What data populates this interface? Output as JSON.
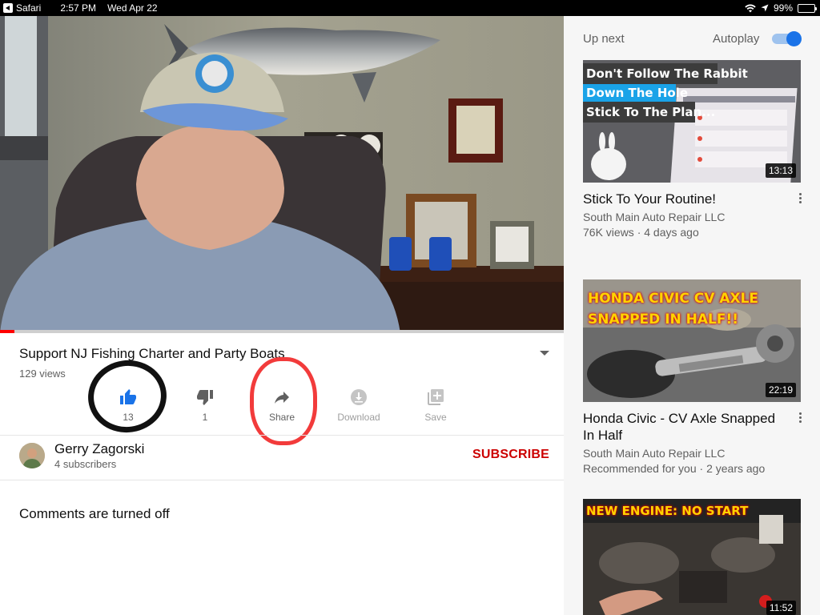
{
  "status_bar": {
    "app": "Safari",
    "time": "2:57 PM",
    "date": "Wed Apr 22",
    "battery": "99%"
  },
  "player": {
    "progress_percent": 2.5,
    "title": "Support NJ Fishing Charter and Party Boats",
    "views": "129 views",
    "actions": {
      "like_count": "13",
      "dislike_count": "1",
      "share_label": "Share",
      "download_label": "Download",
      "save_label": "Save"
    }
  },
  "channel": {
    "name": "Gerry Zagorski",
    "subscribers": "4 subscribers",
    "subscribe_label": "SUBSCRIBE"
  },
  "comments": {
    "status": "Comments are turned off"
  },
  "sidebar": {
    "up_next_label": "Up next",
    "autoplay_label": "Autoplay",
    "videos": [
      {
        "thumb_lines": [
          "Don't Follow The Rabbit",
          "Down The Hole",
          "Stick To The Plan..."
        ],
        "duration": "13:13",
        "title": "Stick To Your Routine!",
        "channel": "South Main Auto Repair LLC",
        "meta": "76K views · 4 days ago"
      },
      {
        "thumb_lines": [
          "HONDA CIVIC CV AXLE",
          "SNAPPED IN HALF!!"
        ],
        "duration": "22:19",
        "title": "Honda Civic - CV Axle Snapped In Half",
        "channel": "South Main Auto Repair LLC",
        "meta": "Recommended for you · 2 years ago"
      },
      {
        "thumb_lines": [
          "NEW ENGINE: NO START"
        ],
        "duration": "11:52"
      }
    ]
  },
  "colors": {
    "subscribe_red": "#cc0000",
    "like_blue": "#1a73e8",
    "progress_red": "#ff0000",
    "annotation_red": "#f23b3b"
  }
}
